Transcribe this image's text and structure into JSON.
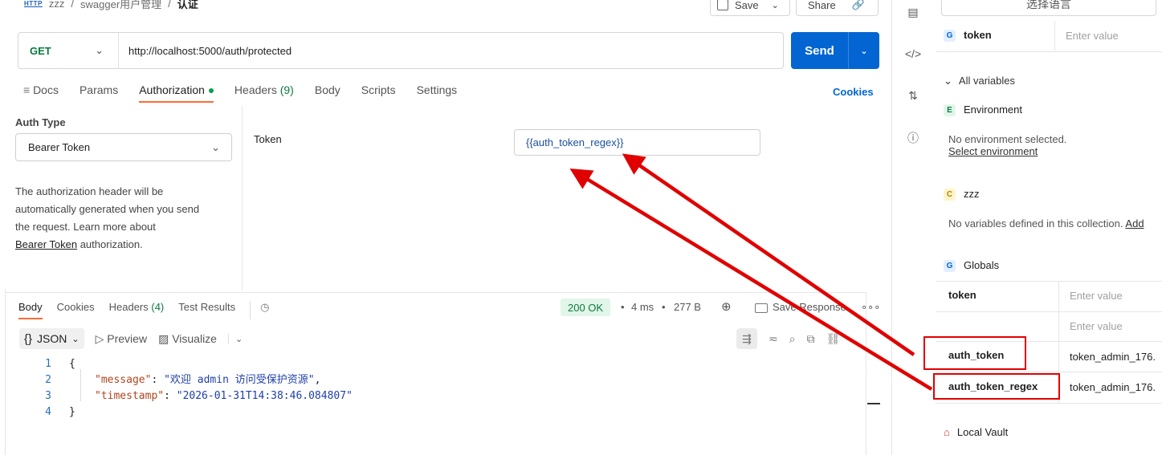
{
  "breadcrumb": {
    "badge": "HTTP",
    "collection": "zzz",
    "folder": "swagger用户管理",
    "current": "认证",
    "sep": "/"
  },
  "toolbar": {
    "save_label": "Save",
    "share_label": "Share"
  },
  "request": {
    "method": "GET",
    "url": "http://localhost:5000/auth/protected",
    "send_label": "Send"
  },
  "tabs": {
    "docs": "Docs",
    "params": "Params",
    "authorization": "Authorization",
    "headers": "Headers",
    "headers_count": "(9)",
    "body": "Body",
    "scripts": "Scripts",
    "settings": "Settings",
    "cookies": "Cookies"
  },
  "auth": {
    "type_label": "Auth Type",
    "type_value": "Bearer Token",
    "desc_1": "The authorization header will be",
    "desc_2": "automatically generated when you send",
    "desc_3": "the request. Learn more about",
    "desc_link": "Bearer Token",
    "desc_4": " authorization.",
    "token_label": "Token",
    "token_value": "{{auth_token_regex}}"
  },
  "response": {
    "tabs": {
      "body": "Body",
      "cookies": "Cookies",
      "headers": "Headers",
      "headers_count": "(4)",
      "test_results": "Test Results"
    },
    "status": "200 OK",
    "time": "4 ms",
    "size": "277 B",
    "save_response": "Save Response",
    "format": "JSON",
    "preview": "Preview",
    "visualize": "Visualize",
    "code": {
      "l1": "{",
      "l2_key": "\"message\"",
      "l2_val": "\"欢迎 admin 访问受保护资源\"",
      "l3_key": "\"timestamp\"",
      "l3_val": "\"2026-01-31T14:38:46.084807\"",
      "l4": "}",
      "n1": "1",
      "n2": "2",
      "n3": "3",
      "n4": "4"
    }
  },
  "right_panel": {
    "language_button": "选择语言",
    "token_var": "token",
    "enter_value": "Enter value",
    "all_variables": "All variables",
    "environment": "Environment",
    "no_env": "No environment selected.",
    "select_env": "Select environment",
    "collection": "zzz",
    "no_vars": "No variables defined in this collection.",
    "add_link": "Add",
    "globals": "Globals",
    "globals_rows": [
      {
        "name": "token",
        "value": "Enter value"
      },
      {
        "name": "",
        "value": "Enter value"
      },
      {
        "name": "auth_token",
        "value": "token_admin_176."
      },
      {
        "name": "auth_token_regex",
        "value": "token_admin_176."
      }
    ],
    "local_vault": "Local Vault"
  },
  "colors": {
    "accent": "#ff6c37",
    "send": "#0265d2",
    "method": "#0a7a3e",
    "annotation": "#e00000"
  }
}
